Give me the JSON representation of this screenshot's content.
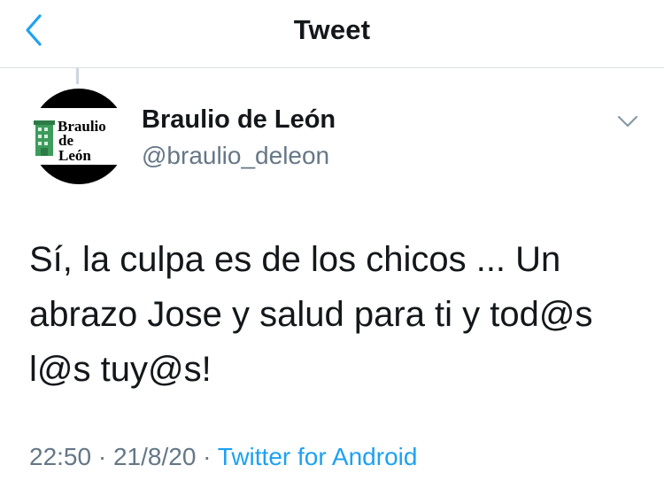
{
  "header": {
    "title": "Tweet"
  },
  "tweet": {
    "author": {
      "display_name": "Braulio de León",
      "handle": "@braulio_deleon",
      "avatar_text": [
        "Braulio",
        "de",
        "León"
      ]
    },
    "text": "Sí, la culpa es de los chicos ... Un abrazo Jose y salud para ti y tod@s l@s tuy@s!",
    "time": "22:50",
    "date": "21/8/20",
    "separator": "·",
    "source": "Twitter for Android"
  },
  "colors": {
    "accent": "#1da1f2",
    "text": "#14171a",
    "secondary": "#657786"
  }
}
